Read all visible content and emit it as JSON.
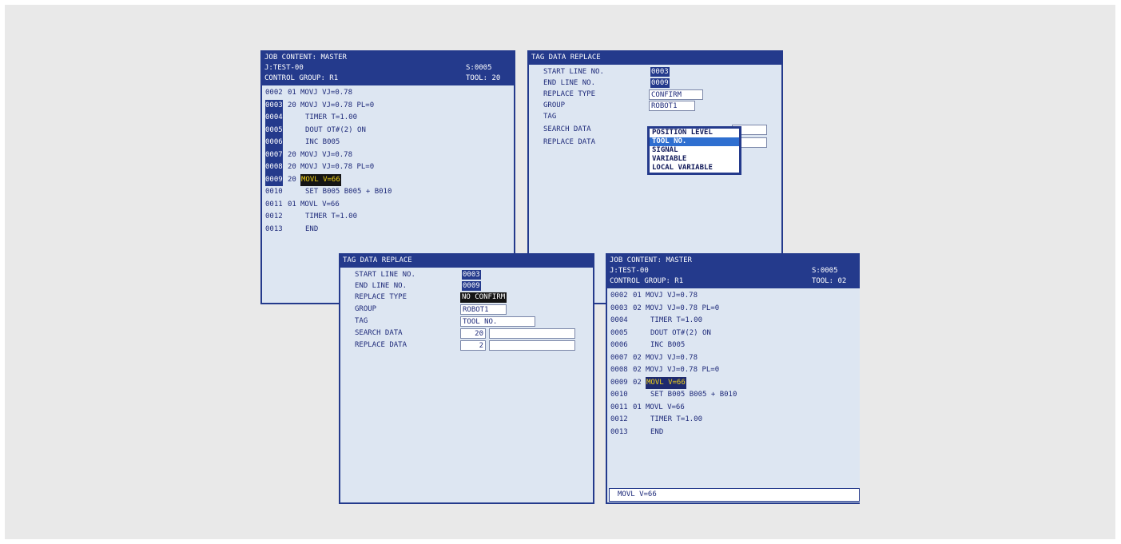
{
  "panel_a": {
    "title": "JOB CONTENT: MASTER",
    "job": "J:TEST-00",
    "step": "S:0005",
    "control_group": "CONTROL GROUP: R1",
    "tool": "TOOL: 20",
    "lines": [
      {
        "num": "0002",
        "tag": "01",
        "text": "MOVJ VJ=0.78",
        "hl": false
      },
      {
        "num": "0003",
        "tag": "20",
        "text": "MOVJ VJ=0.78 PL=0",
        "hl": true
      },
      {
        "num": "0004",
        "tag": "",
        "text": "TIMER T=1.00",
        "hl": true
      },
      {
        "num": "0005",
        "tag": "",
        "text": "DOUT OT#(2) ON",
        "hl": true
      },
      {
        "num": "0006",
        "tag": "",
        "text": "INC B005",
        "hl": true
      },
      {
        "num": "0007",
        "tag": "20",
        "text": "MOVJ VJ=0.78",
        "hl": true
      },
      {
        "num": "0008",
        "tag": "20",
        "text": "MOVJ VJ=0.78 PL=0",
        "hl": true
      },
      {
        "num": "0009",
        "tag": "20",
        "text": "MOVL V=66",
        "hl": true,
        "cursor": true
      },
      {
        "num": "0010",
        "tag": "",
        "text": "SET B005 B005 + B010",
        "hl": false
      },
      {
        "num": "0011",
        "tag": "01",
        "text": "MOVL V=66",
        "hl": false
      },
      {
        "num": "0012",
        "tag": "",
        "text": "TIMER T=1.00",
        "hl": false
      },
      {
        "num": "0013",
        "tag": "",
        "text": "END",
        "hl": false
      }
    ]
  },
  "panel_b": {
    "title": "TAG DATA REPLACE",
    "labels": {
      "start": "START LINE NO.",
      "end": "END LINE NO.",
      "type": "REPLACE TYPE",
      "group": "GROUP",
      "tag": "TAG",
      "search": "SEARCH DATA",
      "replace": "REPLACE DATA"
    },
    "values": {
      "start": "0003",
      "end": "0009",
      "type": "CONFIRM",
      "group": "ROBOT1"
    },
    "dropdown": {
      "options": [
        "POSITION LEVEL",
        "TOOL NO.",
        "SIGNAL",
        "VARIABLE",
        "LOCAL VARIABLE"
      ],
      "selected": "TOOL NO."
    }
  },
  "panel_c": {
    "title": "TAG DATA REPLACE",
    "labels": {
      "start": "START LINE NO.",
      "end": "END LINE NO.",
      "type": "REPLACE TYPE",
      "group": "GROUP",
      "tag": "TAG",
      "search": "SEARCH DATA",
      "replace": "REPLACE DATA"
    },
    "values": {
      "start": "0003",
      "end": "0009",
      "type": "NO CONFIRM",
      "group": "ROBOT1",
      "tag": "TOOL NO.",
      "search": "20",
      "replace": "2"
    }
  },
  "panel_d": {
    "title": "JOB CONTENT: MASTER",
    "job": "J:TEST-00",
    "step": "S:0005",
    "control_group": "CONTROL GROUP: R1",
    "tool": "TOOL: 02",
    "lines": [
      {
        "num": "0002",
        "tag": "01",
        "text": "MOVJ VJ=0.78"
      },
      {
        "num": "0003",
        "tag": "02",
        "text": "MOVJ VJ=0.78 PL=0"
      },
      {
        "num": "0004",
        "tag": "",
        "text": "TIMER T=1.00"
      },
      {
        "num": "0005",
        "tag": "",
        "text": "DOUT OT#(2) ON"
      },
      {
        "num": "0006",
        "tag": "",
        "text": "INC B005"
      },
      {
        "num": "0007",
        "tag": "02",
        "text": "MOVJ VJ=0.78"
      },
      {
        "num": "0008",
        "tag": "02",
        "text": "MOVJ VJ=0.78 PL=0"
      },
      {
        "num": "0009",
        "tag": "02",
        "text": "MOVL V=66",
        "cursor": true
      },
      {
        "num": "0010",
        "tag": "",
        "text": "SET B005 B005 + B010"
      },
      {
        "num": "0011",
        "tag": "01",
        "text": "MOVL V=66"
      },
      {
        "num": "0012",
        "tag": "",
        "text": "TIMER T=1.00"
      },
      {
        "num": "0013",
        "tag": "",
        "text": "END"
      }
    ],
    "status_line": "MOVL V=66"
  }
}
